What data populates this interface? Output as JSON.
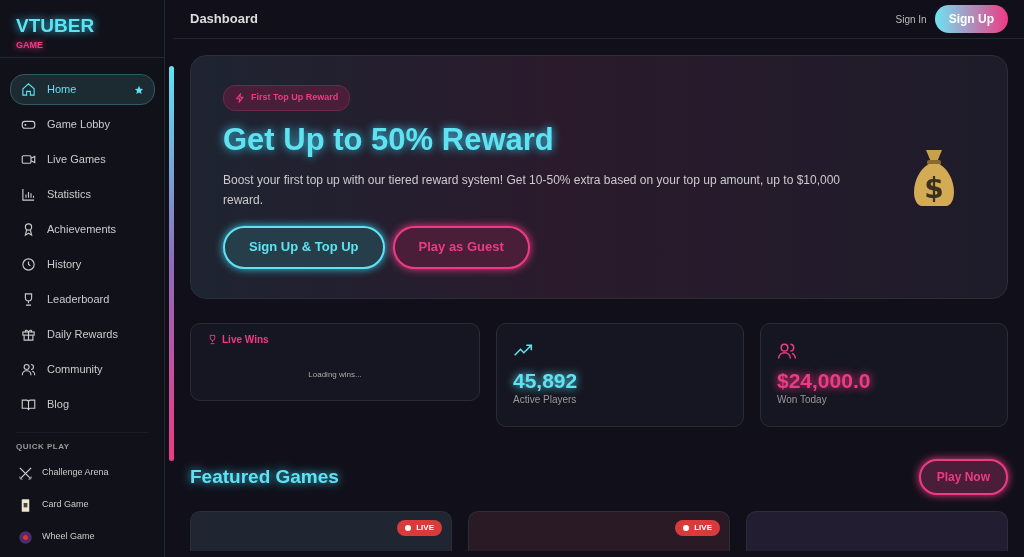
{
  "brand": {
    "title": "VTUBER",
    "subtitle": "GAME"
  },
  "nav": [
    {
      "label": "Home",
      "selected": true
    },
    {
      "label": "Game Lobby",
      "selected": false
    },
    {
      "label": "Live Games",
      "selected": false
    },
    {
      "label": "Statistics",
      "selected": false
    },
    {
      "label": "Achievements",
      "selected": false
    },
    {
      "label": "History",
      "selected": false
    },
    {
      "label": "Leaderboard",
      "selected": false
    },
    {
      "label": "Daily Rewards",
      "selected": false
    },
    {
      "label": "Community",
      "selected": false
    },
    {
      "label": "Blog",
      "selected": false
    }
  ],
  "quick_play": {
    "heading": "QUICK PLAY",
    "items": [
      {
        "label": "Challenge Arena"
      },
      {
        "label": "Card Game"
      },
      {
        "label": "Wheel Game"
      }
    ]
  },
  "header": {
    "title": "Dashboard",
    "sign_in": "Sign In",
    "sign_up": "Sign Up"
  },
  "hero": {
    "badge": "First Top Up Reward",
    "title": "Get Up to 50% Reward",
    "text": "Boost your first top up with our tiered reward system! Get 10-50% extra based on your top up amount, up to $10,000 reward.",
    "bag_symbol": "$",
    "primary": "Sign Up & Top Up",
    "secondary": "Play as Guest"
  },
  "live_wins": {
    "title": "Live Wins",
    "status": "Loading wins..."
  },
  "stats": [
    {
      "value": "45,892",
      "label": "Active Players"
    },
    {
      "value": "$24,000.0",
      "label": "Won Today"
    }
  ],
  "featured": {
    "title": "Featured Games",
    "action": "Play Now",
    "games": [
      {
        "live": true,
        "badge": "LIVE"
      },
      {
        "live": true,
        "badge": "LIVE"
      },
      {
        "live": false
      }
    ]
  }
}
